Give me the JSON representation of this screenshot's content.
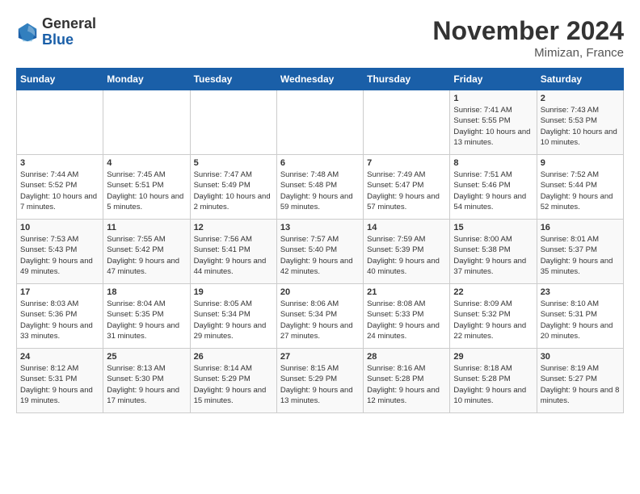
{
  "logo": {
    "line1": "General",
    "line2": "Blue"
  },
  "title": "November 2024",
  "subtitle": "Mimizan, France",
  "weekdays": [
    "Sunday",
    "Monday",
    "Tuesday",
    "Wednesday",
    "Thursday",
    "Friday",
    "Saturday"
  ],
  "weeks": [
    [
      {
        "day": "",
        "info": ""
      },
      {
        "day": "",
        "info": ""
      },
      {
        "day": "",
        "info": ""
      },
      {
        "day": "",
        "info": ""
      },
      {
        "day": "",
        "info": ""
      },
      {
        "day": "1",
        "info": "Sunrise: 7:41 AM\nSunset: 5:55 PM\nDaylight: 10 hours and 13 minutes."
      },
      {
        "day": "2",
        "info": "Sunrise: 7:43 AM\nSunset: 5:53 PM\nDaylight: 10 hours and 10 minutes."
      }
    ],
    [
      {
        "day": "3",
        "info": "Sunrise: 7:44 AM\nSunset: 5:52 PM\nDaylight: 10 hours and 7 minutes."
      },
      {
        "day": "4",
        "info": "Sunrise: 7:45 AM\nSunset: 5:51 PM\nDaylight: 10 hours and 5 minutes."
      },
      {
        "day": "5",
        "info": "Sunrise: 7:47 AM\nSunset: 5:49 PM\nDaylight: 10 hours and 2 minutes."
      },
      {
        "day": "6",
        "info": "Sunrise: 7:48 AM\nSunset: 5:48 PM\nDaylight: 9 hours and 59 minutes."
      },
      {
        "day": "7",
        "info": "Sunrise: 7:49 AM\nSunset: 5:47 PM\nDaylight: 9 hours and 57 minutes."
      },
      {
        "day": "8",
        "info": "Sunrise: 7:51 AM\nSunset: 5:46 PM\nDaylight: 9 hours and 54 minutes."
      },
      {
        "day": "9",
        "info": "Sunrise: 7:52 AM\nSunset: 5:44 PM\nDaylight: 9 hours and 52 minutes."
      }
    ],
    [
      {
        "day": "10",
        "info": "Sunrise: 7:53 AM\nSunset: 5:43 PM\nDaylight: 9 hours and 49 minutes."
      },
      {
        "day": "11",
        "info": "Sunrise: 7:55 AM\nSunset: 5:42 PM\nDaylight: 9 hours and 47 minutes."
      },
      {
        "day": "12",
        "info": "Sunrise: 7:56 AM\nSunset: 5:41 PM\nDaylight: 9 hours and 44 minutes."
      },
      {
        "day": "13",
        "info": "Sunrise: 7:57 AM\nSunset: 5:40 PM\nDaylight: 9 hours and 42 minutes."
      },
      {
        "day": "14",
        "info": "Sunrise: 7:59 AM\nSunset: 5:39 PM\nDaylight: 9 hours and 40 minutes."
      },
      {
        "day": "15",
        "info": "Sunrise: 8:00 AM\nSunset: 5:38 PM\nDaylight: 9 hours and 37 minutes."
      },
      {
        "day": "16",
        "info": "Sunrise: 8:01 AM\nSunset: 5:37 PM\nDaylight: 9 hours and 35 minutes."
      }
    ],
    [
      {
        "day": "17",
        "info": "Sunrise: 8:03 AM\nSunset: 5:36 PM\nDaylight: 9 hours and 33 minutes."
      },
      {
        "day": "18",
        "info": "Sunrise: 8:04 AM\nSunset: 5:35 PM\nDaylight: 9 hours and 31 minutes."
      },
      {
        "day": "19",
        "info": "Sunrise: 8:05 AM\nSunset: 5:34 PM\nDaylight: 9 hours and 29 minutes."
      },
      {
        "day": "20",
        "info": "Sunrise: 8:06 AM\nSunset: 5:34 PM\nDaylight: 9 hours and 27 minutes."
      },
      {
        "day": "21",
        "info": "Sunrise: 8:08 AM\nSunset: 5:33 PM\nDaylight: 9 hours and 24 minutes."
      },
      {
        "day": "22",
        "info": "Sunrise: 8:09 AM\nSunset: 5:32 PM\nDaylight: 9 hours and 22 minutes."
      },
      {
        "day": "23",
        "info": "Sunrise: 8:10 AM\nSunset: 5:31 PM\nDaylight: 9 hours and 20 minutes."
      }
    ],
    [
      {
        "day": "24",
        "info": "Sunrise: 8:12 AM\nSunset: 5:31 PM\nDaylight: 9 hours and 19 minutes."
      },
      {
        "day": "25",
        "info": "Sunrise: 8:13 AM\nSunset: 5:30 PM\nDaylight: 9 hours and 17 minutes."
      },
      {
        "day": "26",
        "info": "Sunrise: 8:14 AM\nSunset: 5:29 PM\nDaylight: 9 hours and 15 minutes."
      },
      {
        "day": "27",
        "info": "Sunrise: 8:15 AM\nSunset: 5:29 PM\nDaylight: 9 hours and 13 minutes."
      },
      {
        "day": "28",
        "info": "Sunrise: 8:16 AM\nSunset: 5:28 PM\nDaylight: 9 hours and 12 minutes."
      },
      {
        "day": "29",
        "info": "Sunrise: 8:18 AM\nSunset: 5:28 PM\nDaylight: 9 hours and 10 minutes."
      },
      {
        "day": "30",
        "info": "Sunrise: 8:19 AM\nSunset: 5:27 PM\nDaylight: 9 hours and 8 minutes."
      }
    ]
  ]
}
